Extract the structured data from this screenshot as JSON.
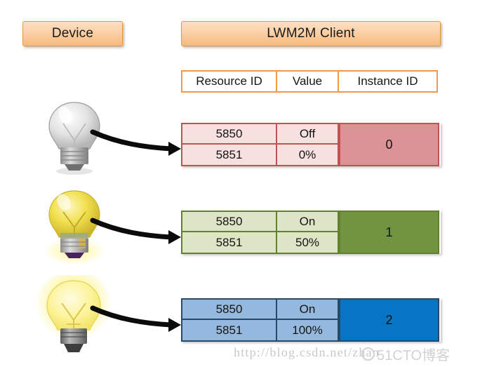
{
  "header": {
    "device_label": "Device",
    "client_label": "LWM2M Client"
  },
  "table": {
    "columns": [
      "Resource ID",
      "Value",
      "Instance ID"
    ],
    "instances": [
      {
        "instance_id": "0",
        "accent_color": "#DB9396",
        "border_color": "#BE5353",
        "cell_color": "#F6E0E0",
        "bulb_state": "off",
        "rows": [
          {
            "resource_id": "5850",
            "value": "Off"
          },
          {
            "resource_id": "5851",
            "value": "0%"
          }
        ]
      },
      {
        "instance_id": "1",
        "accent_color": "#719440",
        "border_color": "#63802F",
        "cell_color": "#DCE5C6",
        "bulb_state": "dim",
        "rows": [
          {
            "resource_id": "5850",
            "value": "On"
          },
          {
            "resource_id": "5851",
            "value": "50%"
          }
        ]
      },
      {
        "instance_id": "2",
        "accent_color": "#0874C4",
        "border_color": "#28496B",
        "cell_color": "#95B8DF",
        "bulb_state": "bright",
        "rows": [
          {
            "resource_id": "5850",
            "value": "On"
          },
          {
            "resource_id": "5851",
            "value": "100%"
          }
        ]
      }
    ]
  },
  "watermark": {
    "url": "http://blog.csdn.net/zhan",
    "site": "51CTO博客"
  }
}
